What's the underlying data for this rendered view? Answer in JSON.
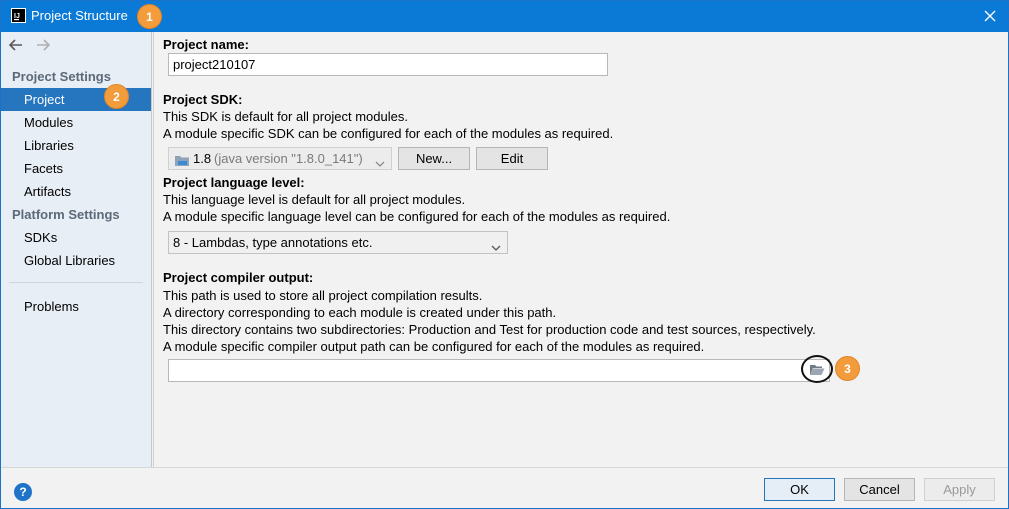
{
  "window": {
    "title": "Project Structure",
    "app_icon_text": "IJ"
  },
  "badges": [
    "1",
    "2",
    "3"
  ],
  "sidebar": {
    "section_project_settings": "Project Settings",
    "items_project": [
      {
        "label": "Project",
        "selected": true
      },
      {
        "label": "Modules"
      },
      {
        "label": "Libraries"
      },
      {
        "label": "Facets"
      },
      {
        "label": "Artifacts"
      }
    ],
    "section_platform_settings": "Platform Settings",
    "items_platform": [
      {
        "label": "SDKs"
      },
      {
        "label": "Global Libraries"
      }
    ],
    "problems": "Problems"
  },
  "main": {
    "project_name": {
      "label": "Project name:",
      "value": "project210107"
    },
    "project_sdk": {
      "label": "Project SDK:",
      "desc1": "This SDK is default for all project modules.",
      "desc2": "A module specific SDK can be configured for each of the modules as required.",
      "selected": "1.8",
      "selected_detail": "(java version \"1.8.0_141\")",
      "new_label": "New...",
      "edit_label": "Edit"
    },
    "language_level": {
      "label": "Project language level:",
      "desc1": "This language level is default for all project modules.",
      "desc2": "A module specific language level can be configured for each of the modules as required.",
      "selected": "8 - Lambdas, type annotations etc."
    },
    "compiler_output": {
      "label": "Project compiler output:",
      "desc1": "This path is used to store all project compilation results.",
      "desc2": "A directory corresponding to each module is created under this path.",
      "desc3": "This directory contains two subdirectories: Production and Test for production code and test sources, respectively.",
      "desc4": "A module specific compiler output path can be configured for each of the modules as required.",
      "value": ""
    }
  },
  "footer": {
    "help_glyph": "?",
    "ok_label": "OK",
    "cancel_label": "Cancel",
    "apply_label": "Apply"
  },
  "colors": {
    "titlebar": "#0a7ad6",
    "selection": "#2675bf",
    "badge": "#f39c3b"
  }
}
